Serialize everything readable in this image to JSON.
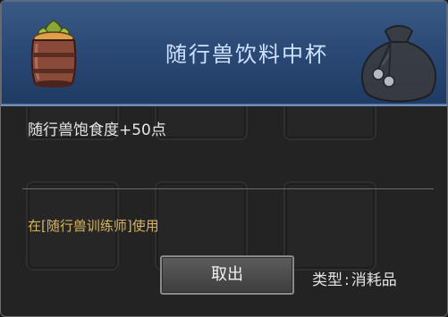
{
  "item": {
    "name": "随行兽饮料中杯",
    "description": "随行兽饱食度+50点",
    "usage": "在[随行兽训练师]使用",
    "type_label": "类型",
    "type_value": "消耗品"
  },
  "buttons": {
    "withdraw_label": "取出"
  },
  "icons": {
    "item": "drink-barrel-icon",
    "watermark": "pouch-bag-icon"
  },
  "colors": {
    "title": "#cfe2ff",
    "usage": "#d6b45a",
    "header": "#2b4a76"
  }
}
